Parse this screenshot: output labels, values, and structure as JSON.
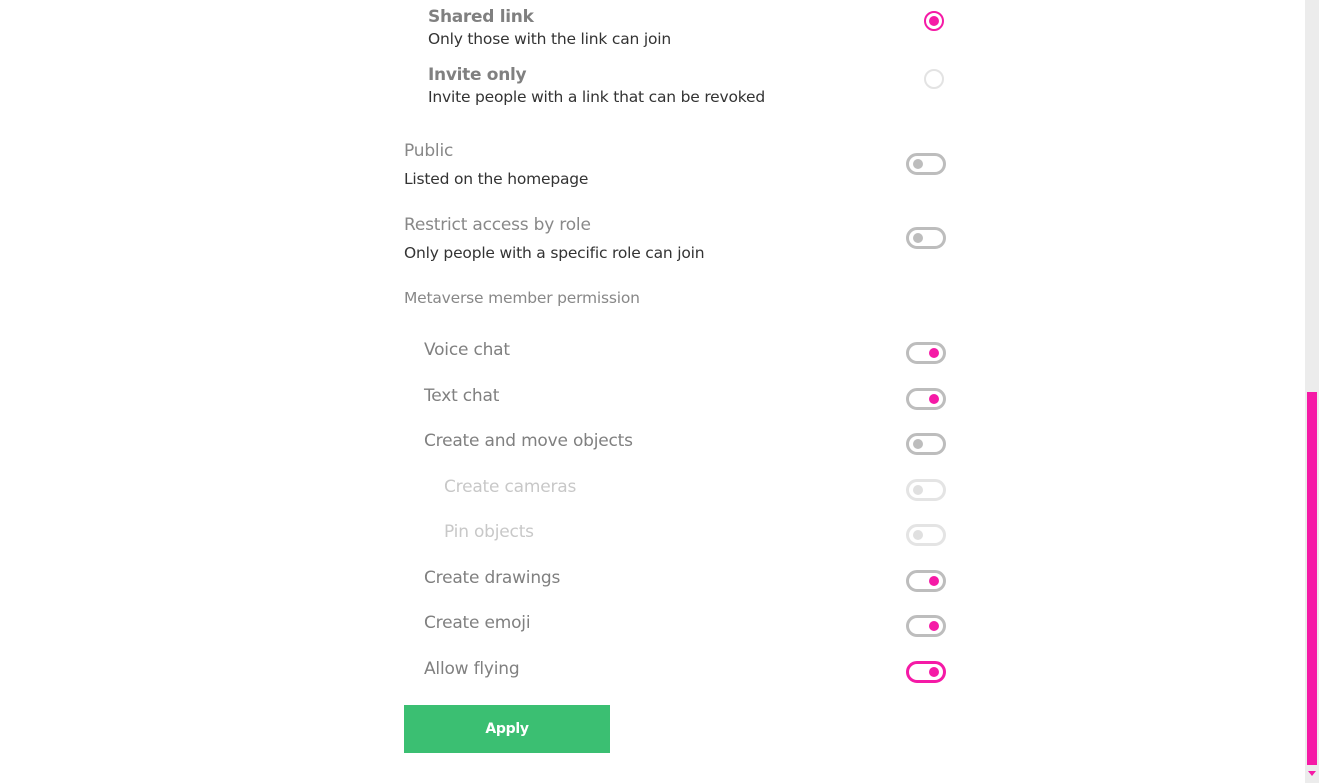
{
  "access": {
    "radio_options": [
      {
        "title": "Shared link",
        "description": "Only those with the link can join",
        "selected": true
      },
      {
        "title": "Invite only",
        "description": "Invite people with a link that can be revoked",
        "selected": false
      }
    ],
    "settings": [
      {
        "title": "Public",
        "description": "Listed on the homepage",
        "enabled": false
      },
      {
        "title": "Restrict access by role",
        "description": "Only people with a specific role can join",
        "enabled": false
      }
    ]
  },
  "permissions": {
    "section_label": "Metaverse member permission",
    "items": [
      {
        "label": "Voice chat",
        "enabled": true,
        "disabled": false,
        "indent": 1
      },
      {
        "label": "Text chat",
        "enabled": true,
        "disabled": false,
        "indent": 1
      },
      {
        "label": "Create and move objects",
        "enabled": false,
        "disabled": false,
        "indent": 1
      },
      {
        "label": "Create cameras",
        "enabled": false,
        "disabled": true,
        "indent": 2
      },
      {
        "label": "Pin objects",
        "enabled": false,
        "disabled": true,
        "indent": 2
      },
      {
        "label": "Create drawings",
        "enabled": true,
        "disabled": false,
        "indent": 1
      },
      {
        "label": "Create emoji",
        "enabled": true,
        "disabled": false,
        "indent": 1
      },
      {
        "label": "Allow flying",
        "enabled": true,
        "disabled": false,
        "indent": 1,
        "focused": true
      }
    ]
  },
  "actions": {
    "apply_label": "Apply"
  },
  "colors": {
    "accent": "#f51aa6",
    "apply": "#3bbf72",
    "toggle_off": "#bdbdbd",
    "label_grey": "#808080"
  },
  "scroll": {
    "position_fraction": 0.5
  }
}
